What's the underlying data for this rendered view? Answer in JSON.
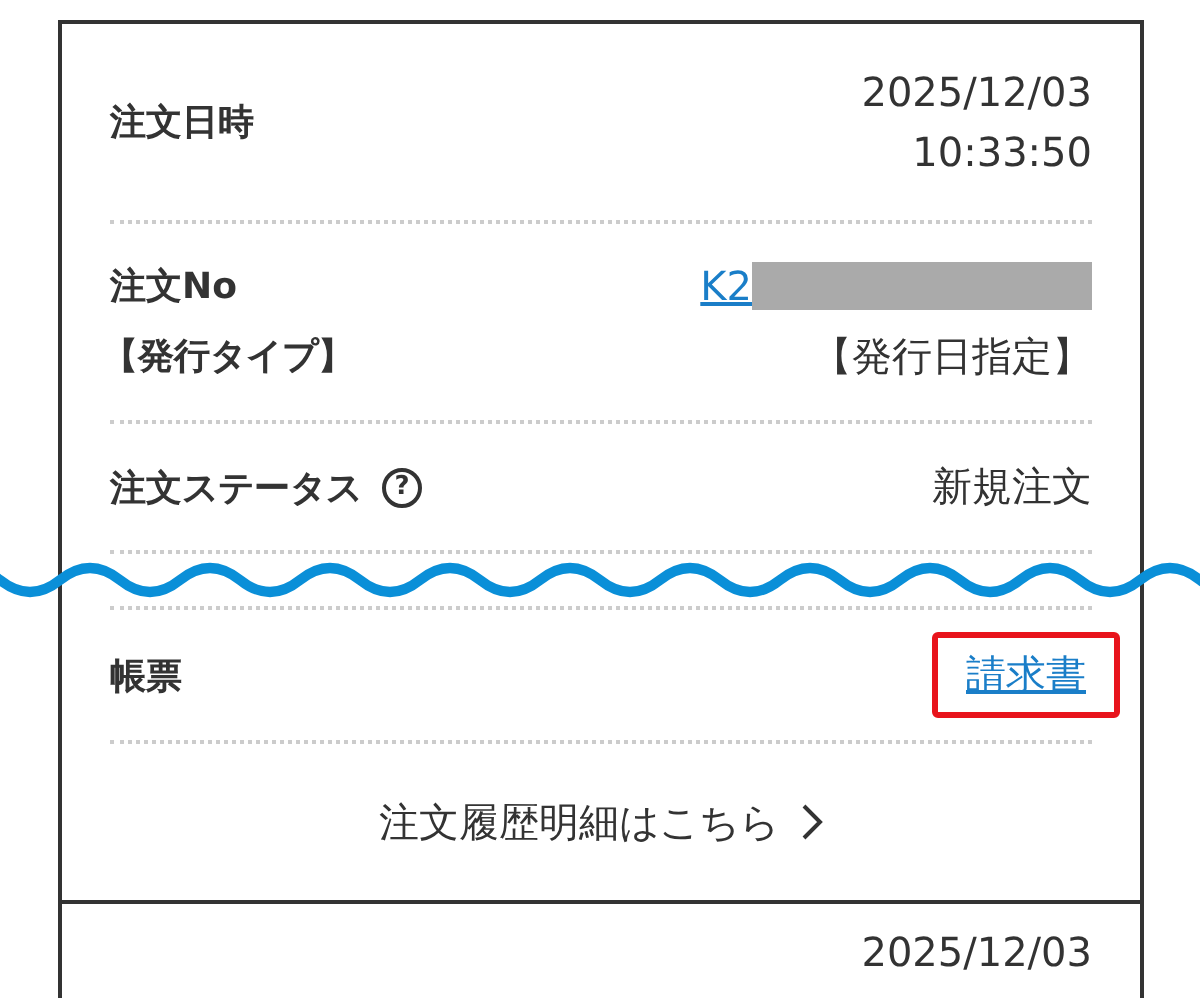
{
  "order": {
    "fields": [
      {
        "kind": "datetime",
        "label": "注文日時",
        "date": "2025/12/03",
        "time": "10:33:50"
      },
      {
        "kind": "order_no",
        "label": "注文No",
        "sublabel": "【発行タイプ】",
        "value": "K2",
        "redacted": true,
        "issue_type": "【発行日指定】"
      },
      {
        "kind": "status",
        "label": "注文ステータス",
        "help": "?",
        "value": "新規注文"
      },
      {
        "kind": "document",
        "label": "帳票",
        "link": "請求書",
        "highlighted": true
      }
    ],
    "omission_wave": true,
    "detail_link": "注文履歴明細はこちら"
  },
  "next_order": {
    "date": "2025/12/03"
  }
}
